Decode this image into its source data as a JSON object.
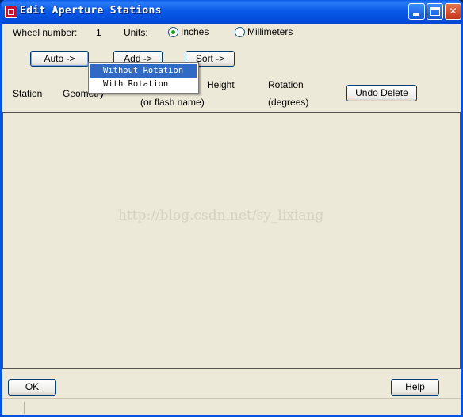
{
  "window": {
    "title": "Edit Aperture Stations"
  },
  "wheel": {
    "label": "Wheel number:",
    "value": "1"
  },
  "units": {
    "label": "Units:",
    "options": [
      "Inches",
      "Millimeters"
    ],
    "selected": "Inches"
  },
  "buttons": {
    "auto": "Auto ->",
    "add": "Add ->",
    "sort": "Sort ->",
    "undo_delete": "Undo Delete",
    "ok": "OK",
    "help": "Help"
  },
  "menu": {
    "items": [
      "Without Rotation",
      "With Rotation"
    ],
    "highlighted": "Without Rotation"
  },
  "columns": {
    "station": "Station",
    "geometry": "Geometry",
    "flash_name": "(or flash name)",
    "height": "Height",
    "rotation": "Rotation",
    "rotation_unit": "(degrees)"
  },
  "watermark": "http://blog.csdn.net/sy_lixiang",
  "colors": {
    "titlebar": "#0a5ae8",
    "window_bg": "#ece9d8",
    "menu_highlight": "#316ac5"
  }
}
